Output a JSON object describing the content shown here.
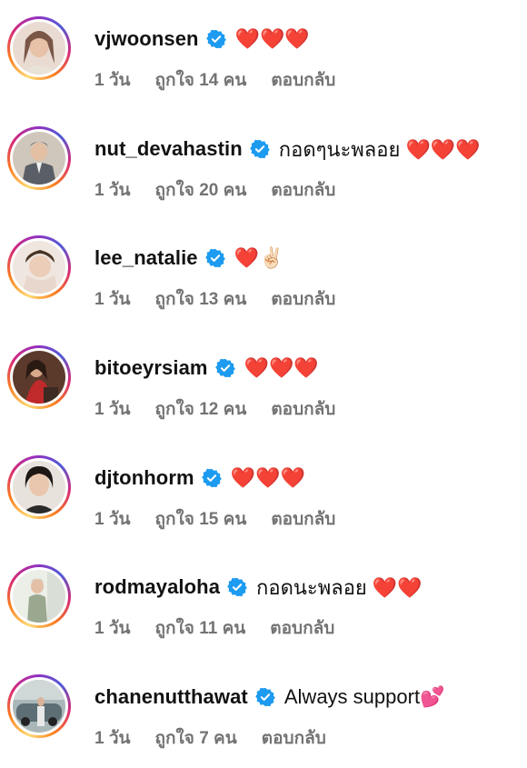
{
  "comments": [
    {
      "username": "vjwoonsen",
      "text": "❤️❤️❤️",
      "time": "1 วัน",
      "likes": "ถูกใจ 14 คน",
      "reply": "ตอบกลับ",
      "avatar_color": "#d9b9a6"
    },
    {
      "username": "nut_devahastin",
      "text": "กอดๆนะพลอย ❤️❤️❤️",
      "time": "1 วัน",
      "likes": "ถูกใจ 20 คน",
      "reply": "ตอบกลับ",
      "avatar_color": "#b8b0a6"
    },
    {
      "username": "lee_natalie",
      "text": "❤️✌🏻",
      "time": "1 วัน",
      "likes": "ถูกใจ 13 คน",
      "reply": "ตอบกลับ",
      "avatar_color": "#e6d2c6"
    },
    {
      "username": "bitoeyrsiam",
      "text": "❤️❤️❤️",
      "time": "1 วัน",
      "likes": "ถูกใจ 12 คน",
      "reply": "ตอบกลับ",
      "avatar_color": "#7a4634"
    },
    {
      "username": "djtonhorm",
      "text": "❤️❤️❤️",
      "time": "1 วัน",
      "likes": "ถูกใจ 15 คน",
      "reply": "ตอบกลับ",
      "avatar_color": "#dcd3cc"
    },
    {
      "username": "rodmayaloha",
      "text": "กอดนะพลอย ❤️❤️",
      "time": "1 วัน",
      "likes": "ถูกใจ 11 คน",
      "reply": "ตอบกลับ",
      "avatar_color": "#c9d1c3"
    },
    {
      "username": "chanenutthawat",
      "text": "Always support💕",
      "time": "1 วัน",
      "likes": "ถูกใจ 7 คน",
      "reply": "ตอบกลับ",
      "avatar_color": "#8ea0a8"
    }
  ],
  "colors": {
    "verified": "#1d9bf0",
    "meta_text": "#737373"
  }
}
